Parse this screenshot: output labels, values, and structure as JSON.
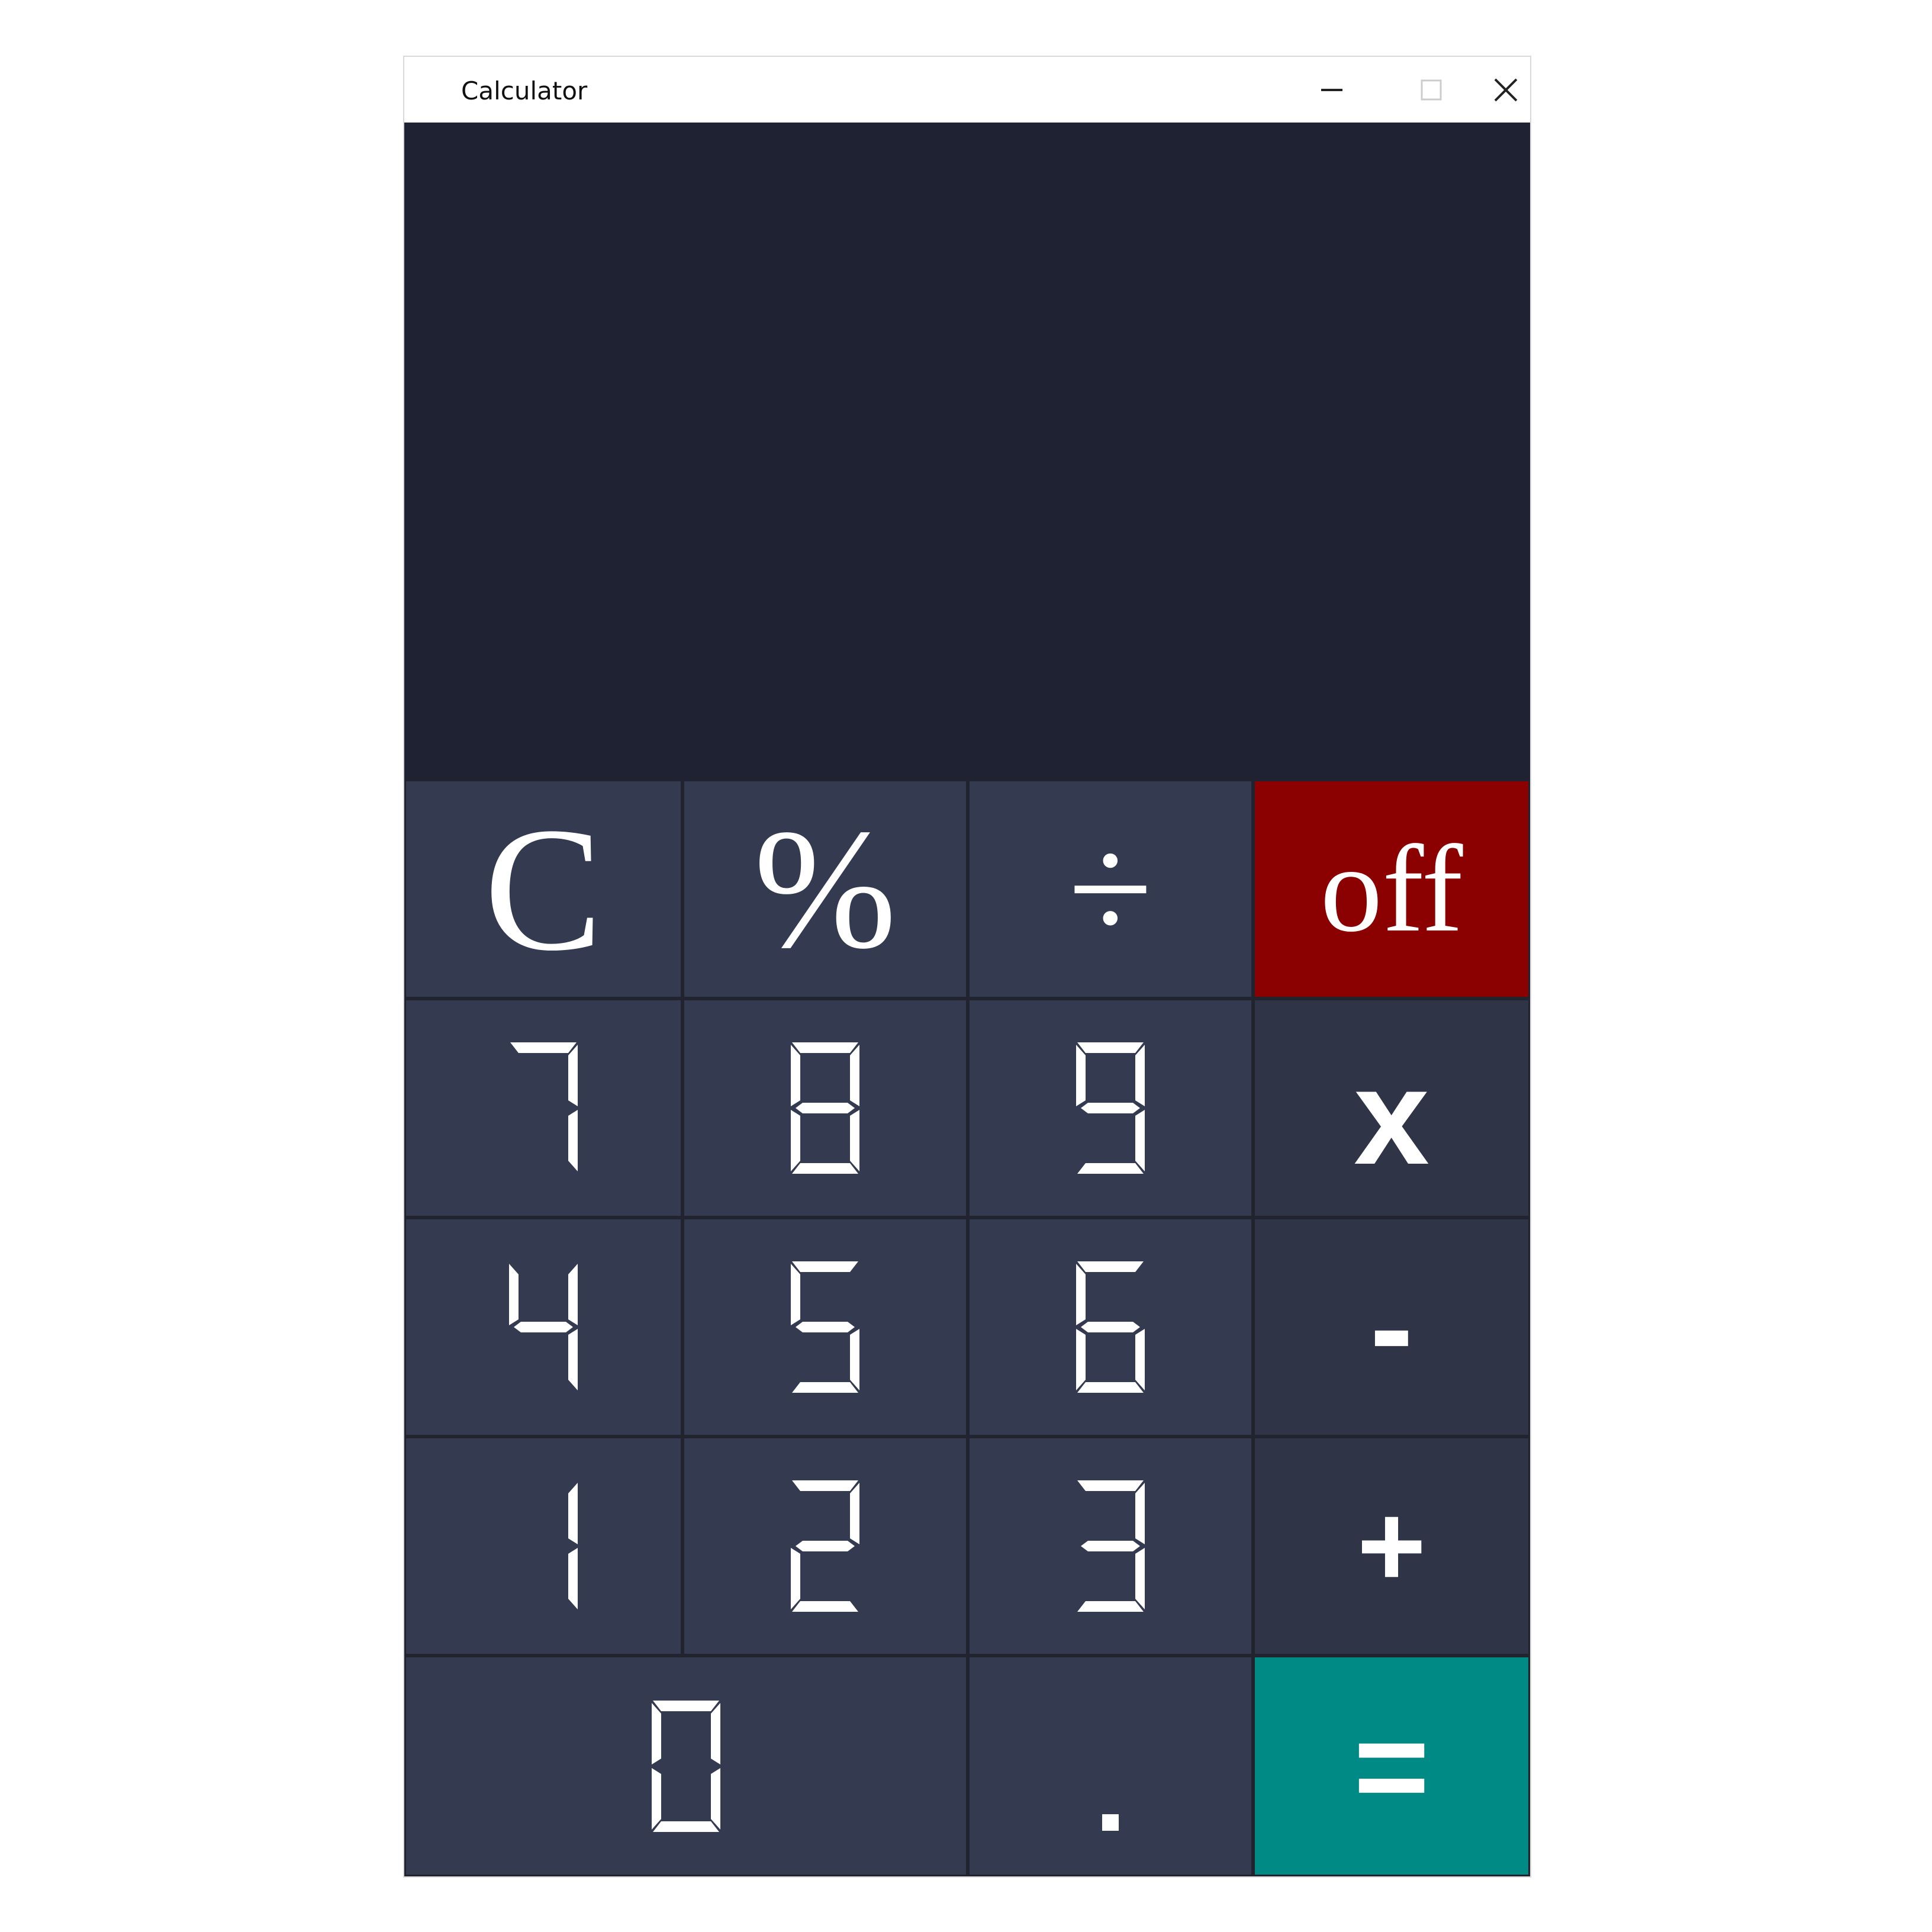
{
  "window": {
    "title": "Calculator",
    "controls": {
      "minimize_icon": "minimize-icon",
      "maximize_icon": "maximize-icon",
      "close_icon": "close-icon"
    }
  },
  "display": {
    "value": ""
  },
  "colors": {
    "display_bg": "#1e2232",
    "key_bg": "#343a4f",
    "off_bg": "#8b0000",
    "equals_bg": "#008a86",
    "text": "#ffffff"
  },
  "keys": {
    "clear": "C",
    "percent": "%",
    "divide": "÷",
    "off": "off",
    "seven": "7",
    "eight": "8",
    "nine": "9",
    "multiply": "x",
    "four": "4",
    "five": "5",
    "six": "6",
    "minus": "-",
    "one": "1",
    "two": "2",
    "three": "3",
    "plus": "+",
    "zero": "0",
    "decimal": ".",
    "equals": "="
  }
}
